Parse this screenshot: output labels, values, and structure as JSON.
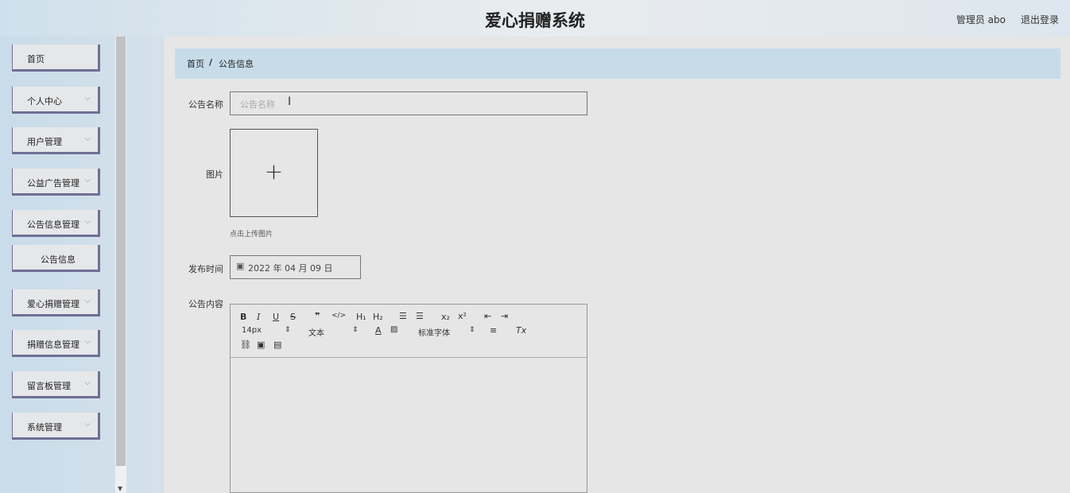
{
  "header": {
    "title": "爱心捐赠系统",
    "user": "管理员 abo",
    "logout": "退出登录"
  },
  "sidebar": {
    "items": [
      {
        "label": "首页",
        "chevron": false
      },
      {
        "label": "个人中心",
        "chevron": true
      },
      {
        "label": "用户管理",
        "chevron": true
      },
      {
        "label": "公益广告管理",
        "chevron": true
      },
      {
        "label": "公告信息管理",
        "chevron": true
      },
      {
        "label": "公告信息",
        "chevron": false,
        "sub": true
      },
      {
        "label": "爱心捐赠管理",
        "chevron": true
      },
      {
        "label": "捐赠信息管理",
        "chevron": true
      },
      {
        "label": "留言板管理",
        "chevron": true
      },
      {
        "label": "系统管理",
        "chevron": true
      }
    ]
  },
  "breadcrumb": {
    "home": "首页",
    "sep": "/",
    "current": "公告信息"
  },
  "form": {
    "name_label": "公告名称",
    "name_placeholder": "公告名称",
    "image_label": "图片",
    "upload_hint": "点击上传图片",
    "date_label": "发布时间",
    "date_value": "2022 年 04 月 09 日",
    "content_label": "公告内容"
  },
  "editor": {
    "font_size": "14px",
    "text_type": "文本",
    "font_family": "标准字体"
  }
}
